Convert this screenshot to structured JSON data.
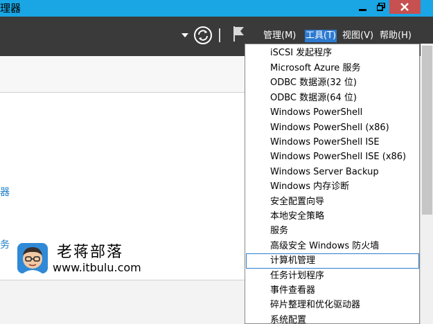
{
  "window": {
    "title": "理器"
  },
  "titlebar": {
    "minimize": "minimize-icon",
    "maximize": "restore-icon",
    "close": "close-icon"
  },
  "header": {
    "menus": [
      {
        "label": "管理(M)"
      },
      {
        "label": "工具(T)"
      },
      {
        "label": "视图(V)"
      },
      {
        "label": "帮助(H)"
      }
    ]
  },
  "sidebar": {
    "items": [
      "器",
      "务"
    ]
  },
  "tools_menu": {
    "items": [
      "iSCSI 发起程序",
      "Microsoft Azure 服务",
      "ODBC 数据源(32 位)",
      "ODBC 数据源(64 位)",
      "Windows PowerShell",
      "Windows PowerShell (x86)",
      "Windows PowerShell ISE",
      "Windows PowerShell ISE (x86)",
      "Windows Server Backup",
      "Windows 内存诊断",
      "安全配置向导",
      "本地安全策略",
      "服务",
      "高级安全 Windows 防火墙",
      "计算机管理",
      "任务计划程序",
      "事件查看器",
      "碎片整理和优化驱动器",
      "系统配置"
    ],
    "selected_index": 14
  },
  "watermark": {
    "title": "老蒋部落",
    "url": "www.itbulu.com"
  },
  "colors": {
    "titlebar": "#1aa6e4",
    "header": "#3a3a3a",
    "accent": "#2d7bd1",
    "close": "#c75050",
    "link": "#1e7fc8"
  }
}
